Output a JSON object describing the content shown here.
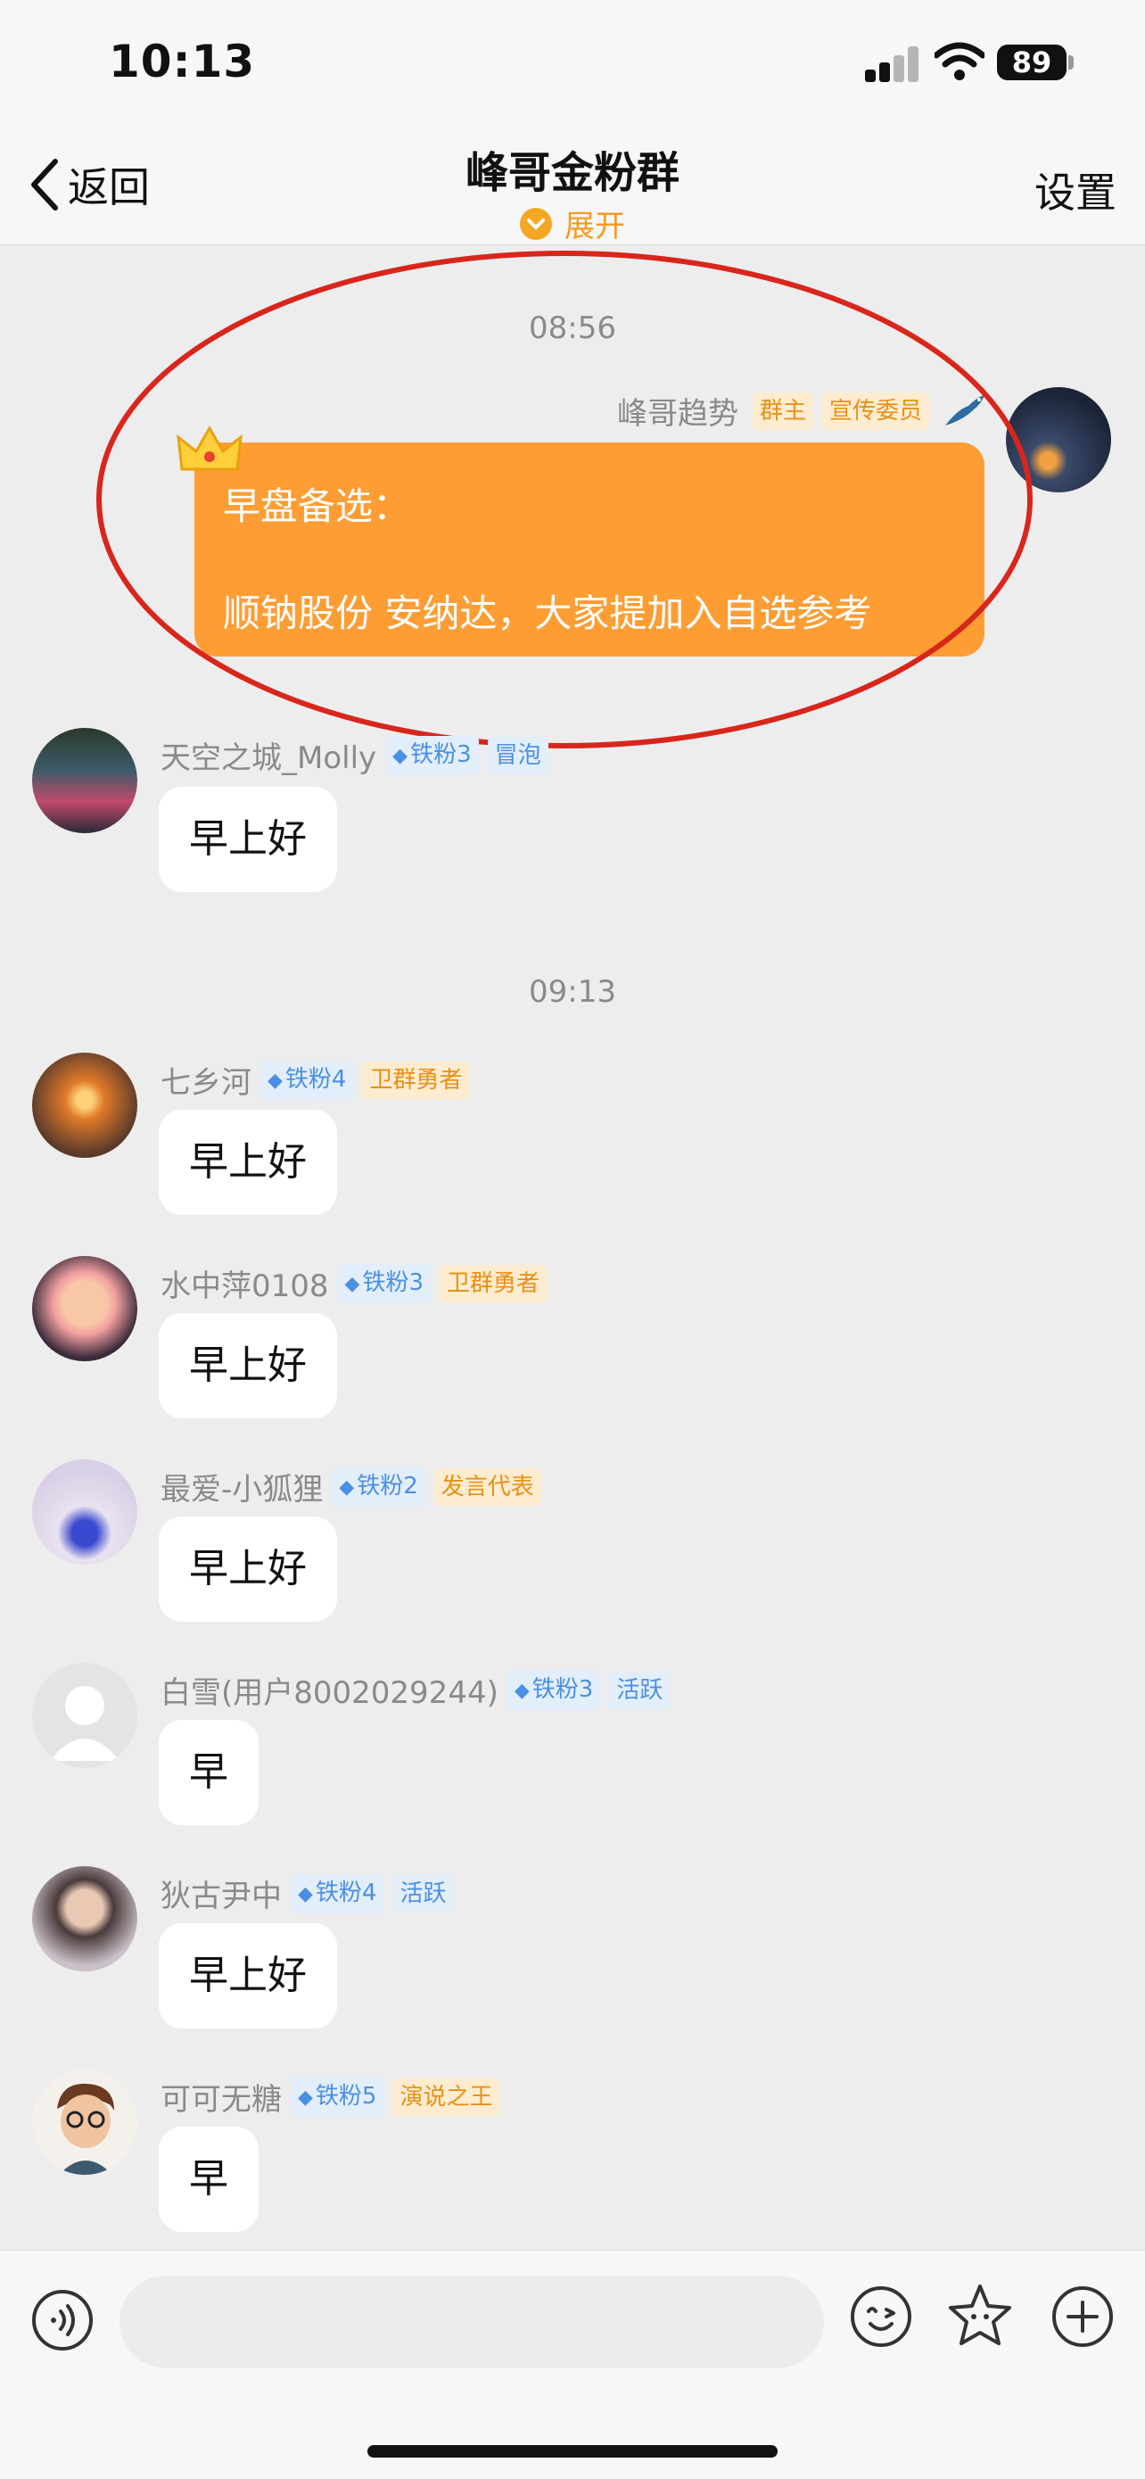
{
  "status_bar": {
    "time": "10:13",
    "battery": "89"
  },
  "nav": {
    "back_label": "返回",
    "title": "峰哥金粉群",
    "expand_label": "展开",
    "settings_label": "设置"
  },
  "messages": [
    {
      "type": "time",
      "text": "08:56"
    },
    {
      "sender": "峰哥趋势",
      "badges": [
        "群主",
        "宣传委员"
      ],
      "lines": [
        "早盘备选：",
        "顺钠股份 安纳达，大家提加入自选参考"
      ],
      "side": "right"
    },
    {
      "sender": "天空之城_Molly",
      "fan": "铁粉3",
      "badge": "冒泡",
      "text": "早上好"
    },
    {
      "type": "time",
      "text": "09:13"
    },
    {
      "sender": "七乡河",
      "fan": "铁粉4",
      "badge": "卫群勇者",
      "text": "早上好"
    },
    {
      "sender": "水中萍0108",
      "fan": "铁粉3",
      "badge": "卫群勇者",
      "text": "早上好"
    },
    {
      "sender": "最爱-小狐狸",
      "fan": "铁粉2",
      "badge": "发言代表",
      "text": "早上好"
    },
    {
      "sender": "白雪(用户8002029244)",
      "fan": "铁粉3",
      "badge": "活跃",
      "text": "早"
    },
    {
      "sender": "狄古尹中",
      "fan": "铁粉4",
      "badge": "活跃",
      "text": "早上好"
    },
    {
      "sender": "可可无糖",
      "fan": "铁粉5",
      "badge": "演说之王",
      "text": "早"
    }
  ],
  "input": {
    "placeholder": ""
  },
  "colors": {
    "accent": "#fd9d33",
    "highlight": "#d9261c",
    "background": "#ededed"
  },
  "icons": [
    "chevron-left-icon",
    "expand-chevron-icon",
    "crown-icon",
    "bird-icon",
    "voice-icon",
    "emoji-icon",
    "sticker-icon",
    "plus-icon"
  ]
}
